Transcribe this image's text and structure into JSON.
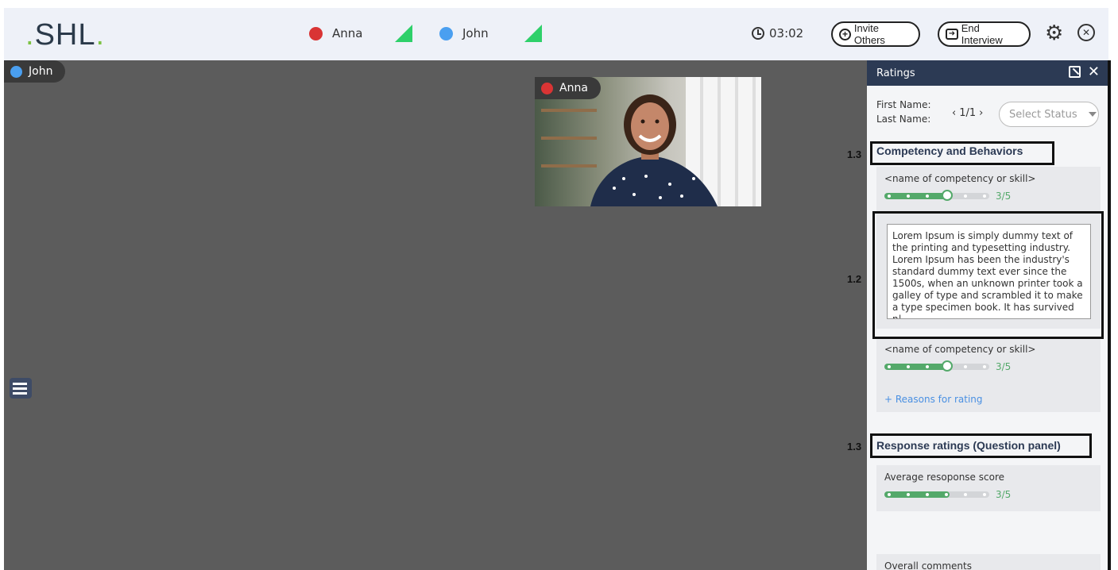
{
  "header": {
    "logo_prefix": ".",
    "logo_text": "SHL",
    "logo_suffix": ".",
    "participants": [
      {
        "name": "Anna",
        "color": "#d93434"
      },
      {
        "name": "John",
        "color": "#4a9ff0"
      }
    ],
    "timer": "03:02",
    "invite_label": "Invite Others",
    "end_label": "End Interview"
  },
  "stage": {
    "main_tag": "John",
    "pip_tag": "Anna"
  },
  "panel": {
    "title": "Ratings",
    "first_name_label": "First Name:",
    "last_name_label": "Last Name:",
    "pager": "1/1",
    "status_placeholder": "Select Status",
    "section1_title": "Competency and Behaviors",
    "competencies": [
      {
        "name": "<name of competency or skill>",
        "score": "3/5",
        "value": 3,
        "max": 5
      },
      {
        "name": "<name of competency or skill>",
        "score": "3/5",
        "value": 3,
        "max": 5
      }
    ],
    "reason_text": "Lorem Ipsum is simply dummy text of the printing and typesetting industry. Lorem Ipsum has been the industry's standard dummy text ever since the 1500s, when an unknown printer took a galley of type and scrambled it to make a type specimen book. It has survived n|",
    "reasons_link": "+ Reasons for rating",
    "section2_title": "Response ratings (Question panel)",
    "average_label": "Average resoponse score",
    "average_score": "3/5",
    "average_value": 3,
    "overall_label": "Overall comments"
  },
  "annotations": {
    "a1": "1.3",
    "a2": "1.2",
    "a3": "1.3"
  },
  "colors": {
    "accent_green": "#54a96a",
    "panel_header": "#2c3a54",
    "stage_bg": "#5c5c5c"
  }
}
